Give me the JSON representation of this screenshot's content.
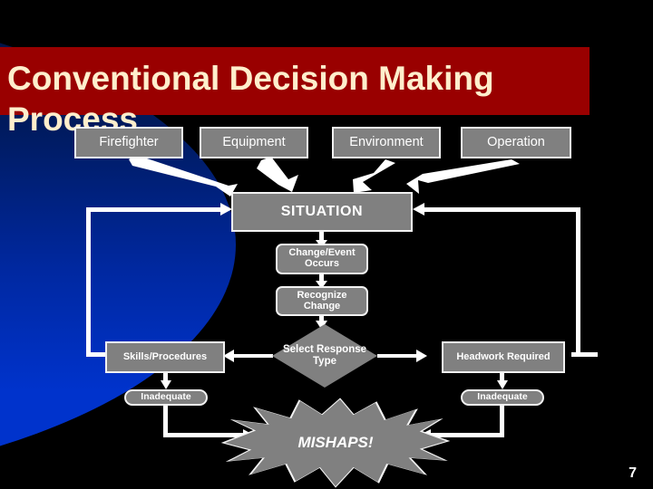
{
  "slide": {
    "title": "Conventional Decision Making Process",
    "page_number": "7",
    "colors": {
      "background": "#000000",
      "banner": "#990000",
      "title_text": "#ffeecc",
      "blue_gradient_top": "#00113d",
      "blue_gradient_bottom": "#0033cc",
      "node_fill": "#808080",
      "node_border": "#f2f2f2",
      "node_text": "#ffffff",
      "connector": "#ffffff"
    }
  },
  "diagram": {
    "type": "flowchart",
    "inputs": [
      {
        "id": "firefighter",
        "label": "Firefighter"
      },
      {
        "id": "equipment",
        "label": "Equipment"
      },
      {
        "id": "environment",
        "label": "Environment"
      },
      {
        "id": "operation",
        "label": "Operation"
      }
    ],
    "nodes": [
      {
        "id": "situation",
        "label": "SITUATION",
        "shape": "rectangle"
      },
      {
        "id": "change-event",
        "label": "Change/Event Occurs",
        "shape": "rounded-rectangle"
      },
      {
        "id": "recognize-change",
        "label": "Recognize Change",
        "shape": "rounded-rectangle"
      },
      {
        "id": "select-response",
        "label": "Select Response Type",
        "shape": "diamond"
      },
      {
        "id": "skills",
        "label": "Skills/Procedures",
        "shape": "rectangle"
      },
      {
        "id": "headwork",
        "label": "Headwork Required",
        "shape": "rectangle"
      },
      {
        "id": "inadequate-left",
        "label": "Inadequate",
        "shape": "rounded-rectangle"
      },
      {
        "id": "inadequate-right",
        "label": "Inadequate",
        "shape": "rounded-rectangle"
      },
      {
        "id": "mishaps",
        "label": "MISHAPS!",
        "shape": "explosion"
      }
    ],
    "edges": [
      {
        "from": "firefighter",
        "to": "situation"
      },
      {
        "from": "equipment",
        "to": "situation"
      },
      {
        "from": "environment",
        "to": "situation"
      },
      {
        "from": "operation",
        "to": "situation"
      },
      {
        "from": "situation",
        "to": "change-event"
      },
      {
        "from": "change-event",
        "to": "recognize-change"
      },
      {
        "from": "recognize-change",
        "to": "select-response"
      },
      {
        "from": "select-response",
        "to": "skills"
      },
      {
        "from": "select-response",
        "to": "headwork"
      },
      {
        "from": "skills",
        "to": "inadequate-left"
      },
      {
        "from": "headwork",
        "to": "inadequate-right"
      },
      {
        "from": "inadequate-left",
        "to": "mishaps"
      },
      {
        "from": "inadequate-right",
        "to": "mishaps"
      },
      {
        "from": "skills",
        "to": "situation",
        "style": "feedback-loop-left"
      },
      {
        "from": "headwork",
        "to": "situation",
        "style": "feedback-loop-right"
      }
    ]
  }
}
